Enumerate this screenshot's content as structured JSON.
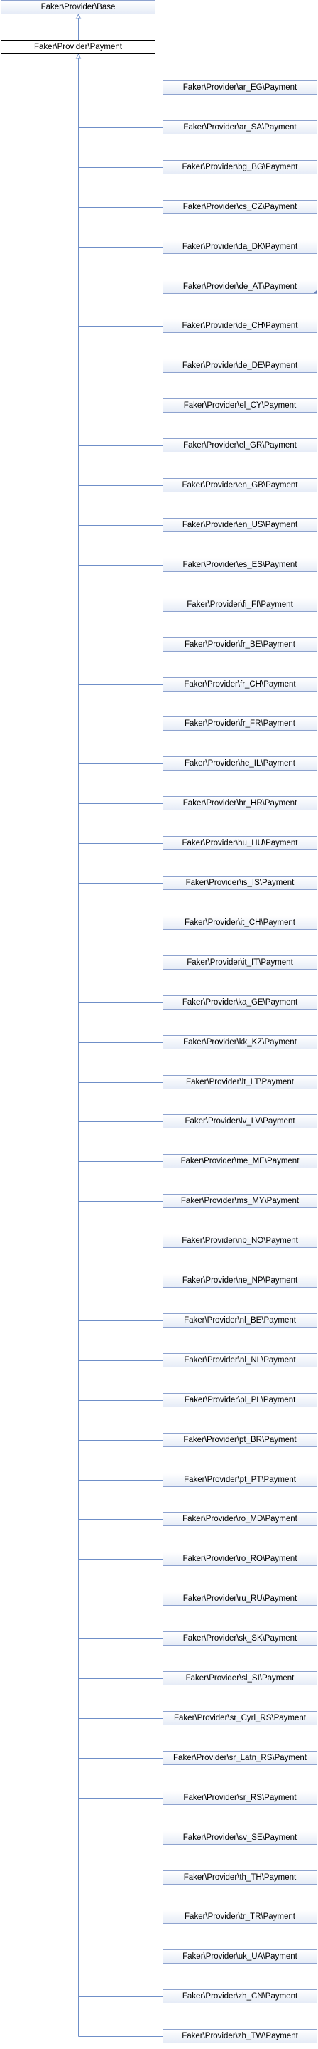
{
  "diagram": {
    "base_class": "Faker\\Provider\\Base",
    "payment_class": "Faker\\Provider\\Payment",
    "edge_color": "#6f8fc8",
    "child_border_color": "#8ea3cf",
    "subclasses": [
      "Faker\\Provider\\ar_EG\\Payment",
      "Faker\\Provider\\ar_SA\\Payment",
      "Faker\\Provider\\bg_BG\\Payment",
      "Faker\\Provider\\cs_CZ\\Payment",
      "Faker\\Provider\\da_DK\\Payment",
      "Faker\\Provider\\de_AT\\Payment",
      "Faker\\Provider\\de_CH\\Payment",
      "Faker\\Provider\\de_DE\\Payment",
      "Faker\\Provider\\el_CY\\Payment",
      "Faker\\Provider\\el_GR\\Payment",
      "Faker\\Provider\\en_GB\\Payment",
      "Faker\\Provider\\en_US\\Payment",
      "Faker\\Provider\\es_ES\\Payment",
      "Faker\\Provider\\fi_FI\\Payment",
      "Faker\\Provider\\fr_BE\\Payment",
      "Faker\\Provider\\fr_CH\\Payment",
      "Faker\\Provider\\fr_FR\\Payment",
      "Faker\\Provider\\he_IL\\Payment",
      "Faker\\Provider\\hr_HR\\Payment",
      "Faker\\Provider\\hu_HU\\Payment",
      "Faker\\Provider\\is_IS\\Payment",
      "Faker\\Provider\\it_CH\\Payment",
      "Faker\\Provider\\it_IT\\Payment",
      "Faker\\Provider\\ka_GE\\Payment",
      "Faker\\Provider\\kk_KZ\\Payment",
      "Faker\\Provider\\lt_LT\\Payment",
      "Faker\\Provider\\lv_LV\\Payment",
      "Faker\\Provider\\me_ME\\Payment",
      "Faker\\Provider\\ms_MY\\Payment",
      "Faker\\Provider\\nb_NO\\Payment",
      "Faker\\Provider\\ne_NP\\Payment",
      "Faker\\Provider\\nl_BE\\Payment",
      "Faker\\Provider\\nl_NL\\Payment",
      "Faker\\Provider\\pl_PL\\Payment",
      "Faker\\Provider\\pt_BR\\Payment",
      "Faker\\Provider\\pt_PT\\Payment",
      "Faker\\Provider\\ro_MD\\Payment",
      "Faker\\Provider\\ro_RO\\Payment",
      "Faker\\Provider\\ru_RU\\Payment",
      "Faker\\Provider\\sk_SK\\Payment",
      "Faker\\Provider\\sl_SI\\Payment",
      "Faker\\Provider\\sr_Cyrl_RS\\Payment",
      "Faker\\Provider\\sr_Latn_RS\\Payment",
      "Faker\\Provider\\sr_RS\\Payment",
      "Faker\\Provider\\sv_SE\\Payment",
      "Faker\\Provider\\th_TH\\Payment",
      "Faker\\Provider\\tr_TR\\Payment",
      "Faker\\Provider\\uk_UA\\Payment",
      "Faker\\Provider\\zh_CN\\Payment",
      "Faker\\Provider\\zh_TW\\Payment"
    ]
  }
}
